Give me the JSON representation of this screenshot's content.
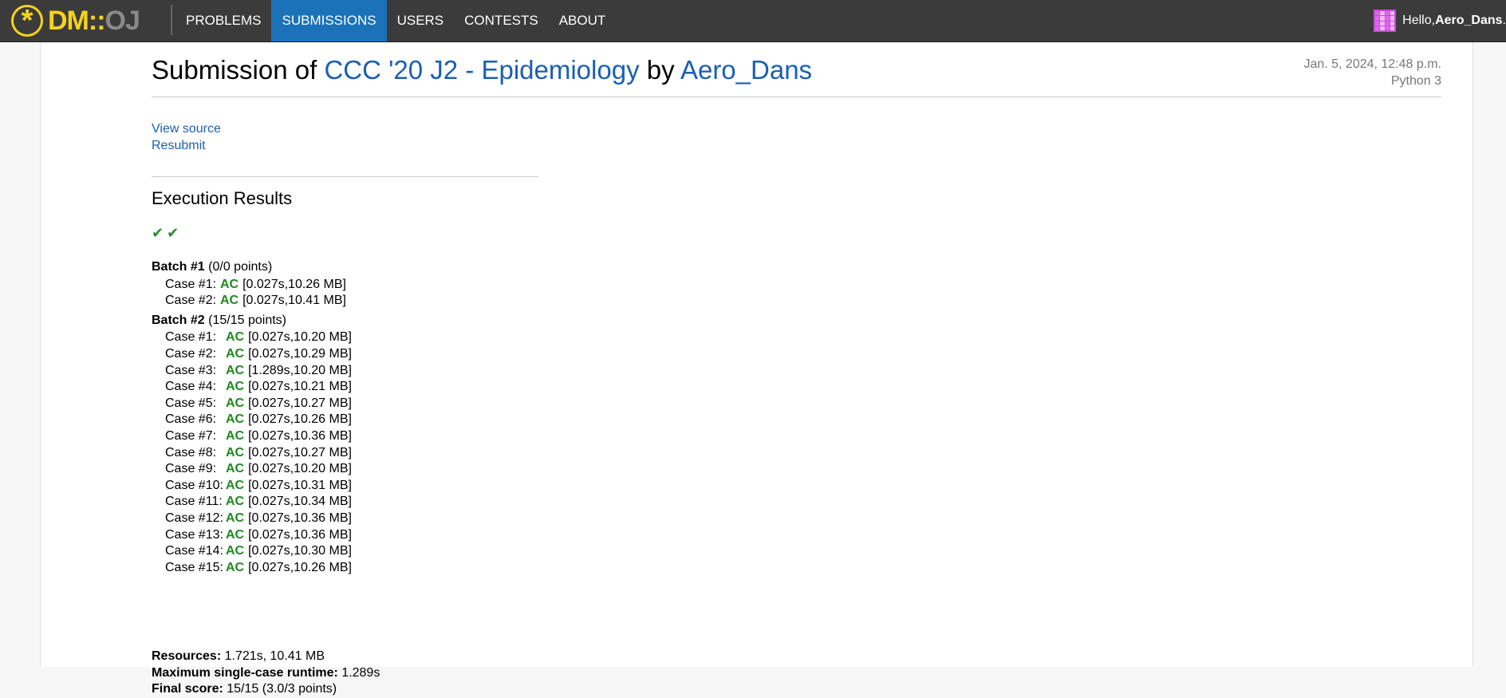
{
  "nav": {
    "logo_dm": "DM",
    "logo_sep": "::",
    "logo_oj": "OJ",
    "items": [
      {
        "label": "PROBLEMS"
      },
      {
        "label": "SUBMISSIONS",
        "active": true
      },
      {
        "label": "USERS"
      },
      {
        "label": "CONTESTS"
      },
      {
        "label": "ABOUT"
      }
    ],
    "greeting": "Hello, ",
    "username": "Aero_Dans",
    "greeting_end": "."
  },
  "submission": {
    "title_prefix": "Submission of ",
    "problem": "CCC '20 J2 - Epidemiology",
    "by": " by ",
    "user": "Aero_Dans",
    "date": "Jan. 5, 2024, 12:48 p.m.",
    "language": "Python 3",
    "view_source": "View source",
    "resubmit": "Resubmit"
  },
  "execution": {
    "title": "Execution Results",
    "checks": "✔✔",
    "batches": [
      {
        "name": "Batch #1",
        "points": " (0/0 points)",
        "cases": [
          {
            "label": "Case #1:",
            "status": "AC",
            "detail": "[0.027s,10.26 MB]"
          },
          {
            "label": "Case #2:",
            "status": "AC",
            "detail": "[0.027s,10.41 MB]"
          }
        ]
      },
      {
        "name": "Batch #2",
        "points": " (15/15 points)",
        "cases": [
          {
            "label": "Case #1:",
            "status": "AC",
            "detail": "[0.027s,10.20 MB]"
          },
          {
            "label": "Case #2:",
            "status": "AC",
            "detail": "[0.027s,10.29 MB]"
          },
          {
            "label": "Case #3:",
            "status": "AC",
            "detail": "[1.289s,10.20 MB]"
          },
          {
            "label": "Case #4:",
            "status": "AC",
            "detail": "[0.027s,10.21 MB]"
          },
          {
            "label": "Case #5:",
            "status": "AC",
            "detail": "[0.027s,10.27 MB]"
          },
          {
            "label": "Case #6:",
            "status": "AC",
            "detail": "[0.027s,10.26 MB]"
          },
          {
            "label": "Case #7:",
            "status": "AC",
            "detail": "[0.027s,10.36 MB]"
          },
          {
            "label": "Case #8:",
            "status": "AC",
            "detail": "[0.027s,10.27 MB]"
          },
          {
            "label": "Case #9:",
            "status": "AC",
            "detail": "[0.027s,10.20 MB]"
          },
          {
            "label": "Case #10:",
            "status": "AC",
            "detail": "[0.027s,10.31 MB]"
          },
          {
            "label": "Case #11:",
            "status": "AC",
            "detail": "[0.027s,10.34 MB]"
          },
          {
            "label": "Case #12:",
            "status": "AC",
            "detail": "[0.027s,10.36 MB]"
          },
          {
            "label": "Case #13:",
            "status": "AC",
            "detail": "[0.027s,10.36 MB]"
          },
          {
            "label": "Case #14:",
            "status": "AC",
            "detail": "[0.027s,10.30 MB]"
          },
          {
            "label": "Case #15:",
            "status": "AC",
            "detail": "[0.027s,10.26 MB]"
          }
        ]
      }
    ],
    "summary": {
      "resources_label": "Resources:",
      "resources_value": " 1.721s, 10.41 MB",
      "max_label": "Maximum single-case runtime:",
      "max_value": " 1.289s",
      "score_label": "Final score:",
      "score_value": " 15/15 (3.0/3 points)"
    }
  },
  "colors": {
    "navbar": "#3b3b3b",
    "active_tab": "#1b72b8",
    "link": "#1a5fb4",
    "ac": "#1e8a1e",
    "logo": "#f6d21a"
  }
}
